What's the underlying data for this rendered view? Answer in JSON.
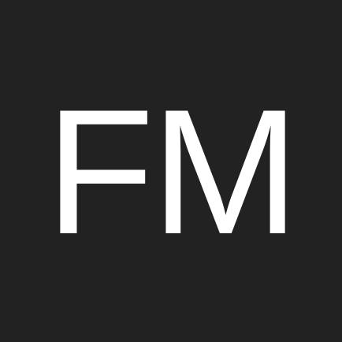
{
  "app_icon": {
    "monogram": "FM",
    "background_color": "#222222",
    "text_color": "#ffffff"
  }
}
